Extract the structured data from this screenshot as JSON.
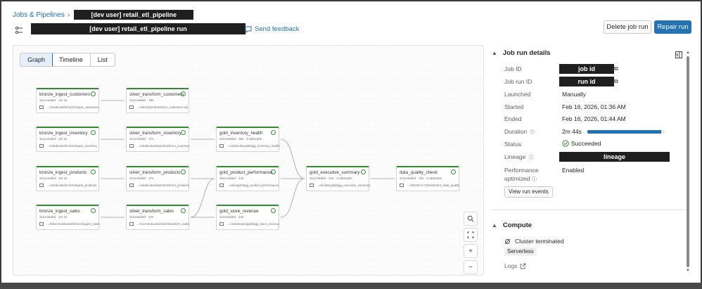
{
  "breadcrumb": {
    "root": "Jobs & Pipelines",
    "job": "[dev user] retail_etl_pipeline"
  },
  "title": {
    "run_name": "[dev user] retail_etl_pipeline run",
    "feedback": "Send feedback"
  },
  "actions": {
    "delete": "Delete job run",
    "repair": "Repair run"
  },
  "views": {
    "tabs": [
      "Graph",
      "Timeline",
      "List"
    ],
    "active": "Graph"
  },
  "nodes": [
    {
      "name": "bronze_ingest_customers",
      "status": "Succeeded · 1m 1s",
      "path": "…/notebooks/bronze/ingest_customers"
    },
    {
      "name": "bronze_ingest_inventory",
      "status": "Succeeded · 1m 1s",
      "path": "…/notebooks/bronze/ingest_inventory"
    },
    {
      "name": "bronze_ingest_products",
      "status": "Succeeded · 1m 1s",
      "path": "…/notebooks/bronze/ingest_products"
    },
    {
      "name": "bronze_ingest_sales",
      "status": "Succeeded · 1m 1s",
      "path": "…/D/src/notebooks/bronze/ingest_sales"
    },
    {
      "name": "silver_transform_customers",
      "status": "Succeeded · 18s",
      "path": "…ooks/silver/transform_customers.sql"
    },
    {
      "name": "silver_transform_inventory",
      "status": "Succeeded · 17s",
      "path": "…/notebooks/silver/transform_inventory"
    },
    {
      "name": "silver_transform_products",
      "status": "Succeeded · 17s",
      "path": "…/notebooks/silver/transform_products"
    },
    {
      "name": "silver_transform_sales",
      "status": "Succeeded · 17s",
      "path": "…/src/notebooks/silver/transform_sales"
    },
    {
      "name": "gold_inventory_health",
      "status": "Succeeded · 35s · 3 attempts",
      "path": "…notebooks/gold/agg_inventory_health"
    },
    {
      "name": "gold_product_performance",
      "status": "Succeeded · 14s",
      "path": "…ooks/gold/agg_product_performance"
    },
    {
      "name": "gold_store_revenue",
      "status": "Succeeded · 14s",
      "path": "…c/notebooks/gold/agg_store_revenue"
    },
    {
      "name": "gold_executive_summary",
      "status": "Succeeded · 14s · 2 attempts",
      "path": "…ebooks/gold/agg_executive_summary"
    },
    {
      "name": "data_quality_check",
      "status": "Succeeded · 12s · 2 attempts",
      "path": "…m/DAB-CI-CD/tests/test_data_quality"
    }
  ],
  "details": {
    "heading": "Job run details",
    "job_id_label": "Job ID",
    "job_id": "job id",
    "run_id_label": "Job run ID",
    "run_id": "run id",
    "launched_label": "Launched",
    "launched": "Manually",
    "started_label": "Started",
    "started": "Feb 16, 2026, 01:36 AM",
    "ended_label": "Ended",
    "ended": "Feb 16, 2026, 01:44 AM",
    "duration_label": "Duration",
    "duration": "2m 44s",
    "duration_fraction": 0.95,
    "status_label": "Status",
    "status": "Succeeded",
    "lineage_label": "Lineage",
    "lineage": "lineage",
    "perf_label_1": "Performance",
    "perf_label_2": "optimized",
    "perf": "Enabled",
    "view_events": "View run events"
  },
  "compute": {
    "heading": "Compute",
    "cluster": "Cluster terminated",
    "type": "Serverless",
    "logs": "Logs"
  },
  "colors": {
    "accent": "#2272b4",
    "success": "#2f8f2f"
  }
}
